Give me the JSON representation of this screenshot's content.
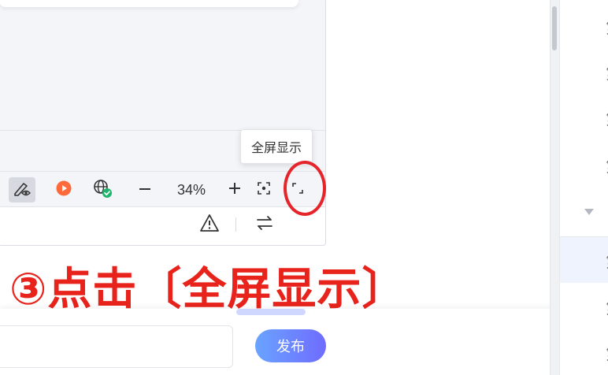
{
  "toolbar": {
    "zoom": "34%",
    "tooltip": "全屏显示"
  },
  "annotation": {
    "text": "③点击〔全屏显示〕"
  },
  "comment": {
    "value": "",
    "placeholder": ""
  },
  "publish": {
    "label": "发布"
  },
  "sidebar": {
    "items": [
      {
        "label": "第"
      },
      {
        "label": "第"
      },
      {
        "label": "第"
      },
      {
        "label": "第"
      },
      {
        "label": "第"
      },
      {
        "label": "第"
      },
      {
        "label": "第"
      }
    ]
  },
  "colors": {
    "highlight_red": "#e5252a",
    "annotation_red": "#e8231c",
    "publish_gradient_start": "#6aa3ff",
    "publish_gradient_end": "#6f6cff",
    "check_green": "#1fb36b",
    "play_orange": "#ff6a3d"
  },
  "icons": {
    "pen": "pen-eye-icon",
    "play": "play-icon",
    "globe": "globe-check-icon",
    "minus": "minus-icon",
    "plus": "plus-icon",
    "focus": "focus-frame-icon",
    "fullscreen": "fullscreen-icon",
    "warning": "warning-icon",
    "swap": "swap-arrows-icon"
  }
}
